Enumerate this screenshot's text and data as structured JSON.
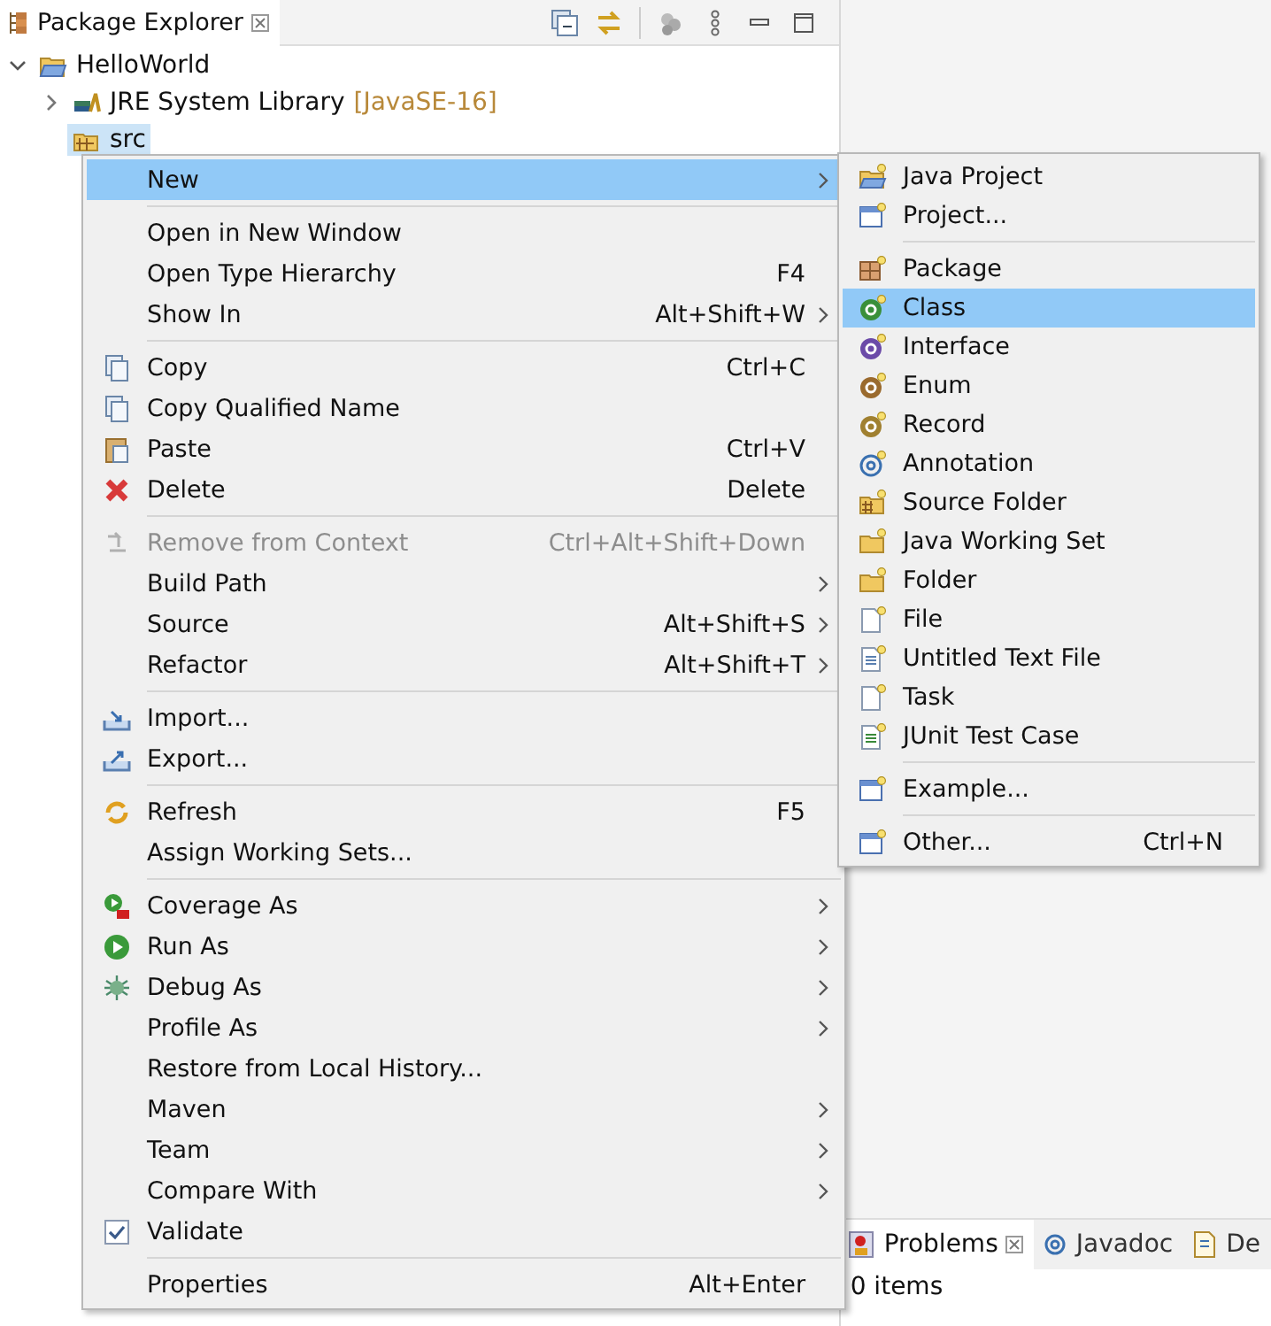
{
  "explorer": {
    "title": "Package Explorer",
    "tree": [
      {
        "label": "HelloWorld",
        "expanded": true,
        "selected": false,
        "children": [
          {
            "label": "JRE System Library",
            "decoration": "[JavaSE-16]",
            "expanded": false,
            "selected": false
          },
          {
            "label": "src",
            "selected": true
          }
        ]
      }
    ]
  },
  "context_menu": {
    "items": [
      {
        "kind": "item",
        "label": "New",
        "submenu": true,
        "selected": true
      },
      {
        "kind": "separator"
      },
      {
        "kind": "item",
        "label": "Open in New Window",
        "selected": false
      },
      {
        "kind": "item",
        "label": "Open Type Hierarchy",
        "shortcut": "F4",
        "selected": false
      },
      {
        "kind": "item",
        "label": "Show In",
        "shortcut": "Alt+Shift+W",
        "submenu": true,
        "selected": false
      },
      {
        "kind": "separator"
      },
      {
        "kind": "item",
        "label": "Copy",
        "shortcut": "Ctrl+C",
        "selected": false
      },
      {
        "kind": "item",
        "label": "Copy Qualified Name",
        "selected": false
      },
      {
        "kind": "item",
        "label": "Paste",
        "shortcut": "Ctrl+V",
        "selected": false
      },
      {
        "kind": "item",
        "label": "Delete",
        "shortcut": "Delete",
        "selected": false
      },
      {
        "kind": "separator"
      },
      {
        "kind": "item",
        "label": "Remove from Context",
        "shortcut": "Ctrl+Alt+Shift+Down",
        "disabled": true,
        "selected": false
      },
      {
        "kind": "item",
        "label": "Build Path",
        "submenu": true,
        "selected": false
      },
      {
        "kind": "item",
        "label": "Source",
        "shortcut": "Alt+Shift+S",
        "submenu": true,
        "selected": false
      },
      {
        "kind": "item",
        "label": "Refactor",
        "shortcut": "Alt+Shift+T",
        "submenu": true,
        "selected": false
      },
      {
        "kind": "separator"
      },
      {
        "kind": "item",
        "label": "Import...",
        "selected": false
      },
      {
        "kind": "item",
        "label": "Export...",
        "selected": false
      },
      {
        "kind": "separator"
      },
      {
        "kind": "item",
        "label": "Refresh",
        "shortcut": "F5",
        "selected": false
      },
      {
        "kind": "item",
        "label": "Assign Working Sets...",
        "selected": false
      },
      {
        "kind": "separator"
      },
      {
        "kind": "item",
        "label": "Coverage As",
        "submenu": true,
        "selected": false
      },
      {
        "kind": "item",
        "label": "Run As",
        "submenu": true,
        "selected": false
      },
      {
        "kind": "item",
        "label": "Debug As",
        "submenu": true,
        "selected": false
      },
      {
        "kind": "item",
        "label": "Profile As",
        "submenu": true,
        "selected": false
      },
      {
        "kind": "item",
        "label": "Restore from Local History...",
        "selected": false
      },
      {
        "kind": "item",
        "label": "Maven",
        "submenu": true,
        "selected": false
      },
      {
        "kind": "item",
        "label": "Team",
        "submenu": true,
        "selected": false
      },
      {
        "kind": "item",
        "label": "Compare With",
        "submenu": true,
        "selected": false
      },
      {
        "kind": "check",
        "label": "Validate",
        "checked": true,
        "selected": false
      },
      {
        "kind": "separator"
      },
      {
        "kind": "item",
        "label": "Properties",
        "shortcut": "Alt+Enter",
        "selected": false
      }
    ]
  },
  "submenu": {
    "items": [
      {
        "kind": "item",
        "label": "Java Project",
        "selected": false
      },
      {
        "kind": "item",
        "label": "Project...",
        "selected": false
      },
      {
        "kind": "separator"
      },
      {
        "kind": "item",
        "label": "Package",
        "selected": false
      },
      {
        "kind": "item",
        "label": "Class",
        "selected": true
      },
      {
        "kind": "item",
        "label": "Interface",
        "selected": false
      },
      {
        "kind": "item",
        "label": "Enum",
        "selected": false
      },
      {
        "kind": "item",
        "label": "Record",
        "selected": false
      },
      {
        "kind": "item",
        "label": "Annotation",
        "selected": false
      },
      {
        "kind": "item",
        "label": "Source Folder",
        "selected": false
      },
      {
        "kind": "item",
        "label": "Java Working Set",
        "selected": false
      },
      {
        "kind": "item",
        "label": "Folder",
        "selected": false
      },
      {
        "kind": "item",
        "label": "File",
        "selected": false
      },
      {
        "kind": "item",
        "label": "Untitled Text File",
        "selected": false
      },
      {
        "kind": "item",
        "label": "Task",
        "selected": false
      },
      {
        "kind": "item",
        "label": "JUnit Test Case",
        "selected": false
      },
      {
        "kind": "separator"
      },
      {
        "kind": "item",
        "label": "Example...",
        "selected": false
      },
      {
        "kind": "separator"
      },
      {
        "kind": "item",
        "label": "Other...",
        "shortcut": "Ctrl+N",
        "selected": false
      }
    ]
  },
  "bottom_panel": {
    "tabs": [
      {
        "label": "Problems",
        "selected": true
      },
      {
        "label": "Javadoc",
        "selected": false
      },
      {
        "label": "De",
        "selected": false
      }
    ],
    "status": "0 items"
  }
}
